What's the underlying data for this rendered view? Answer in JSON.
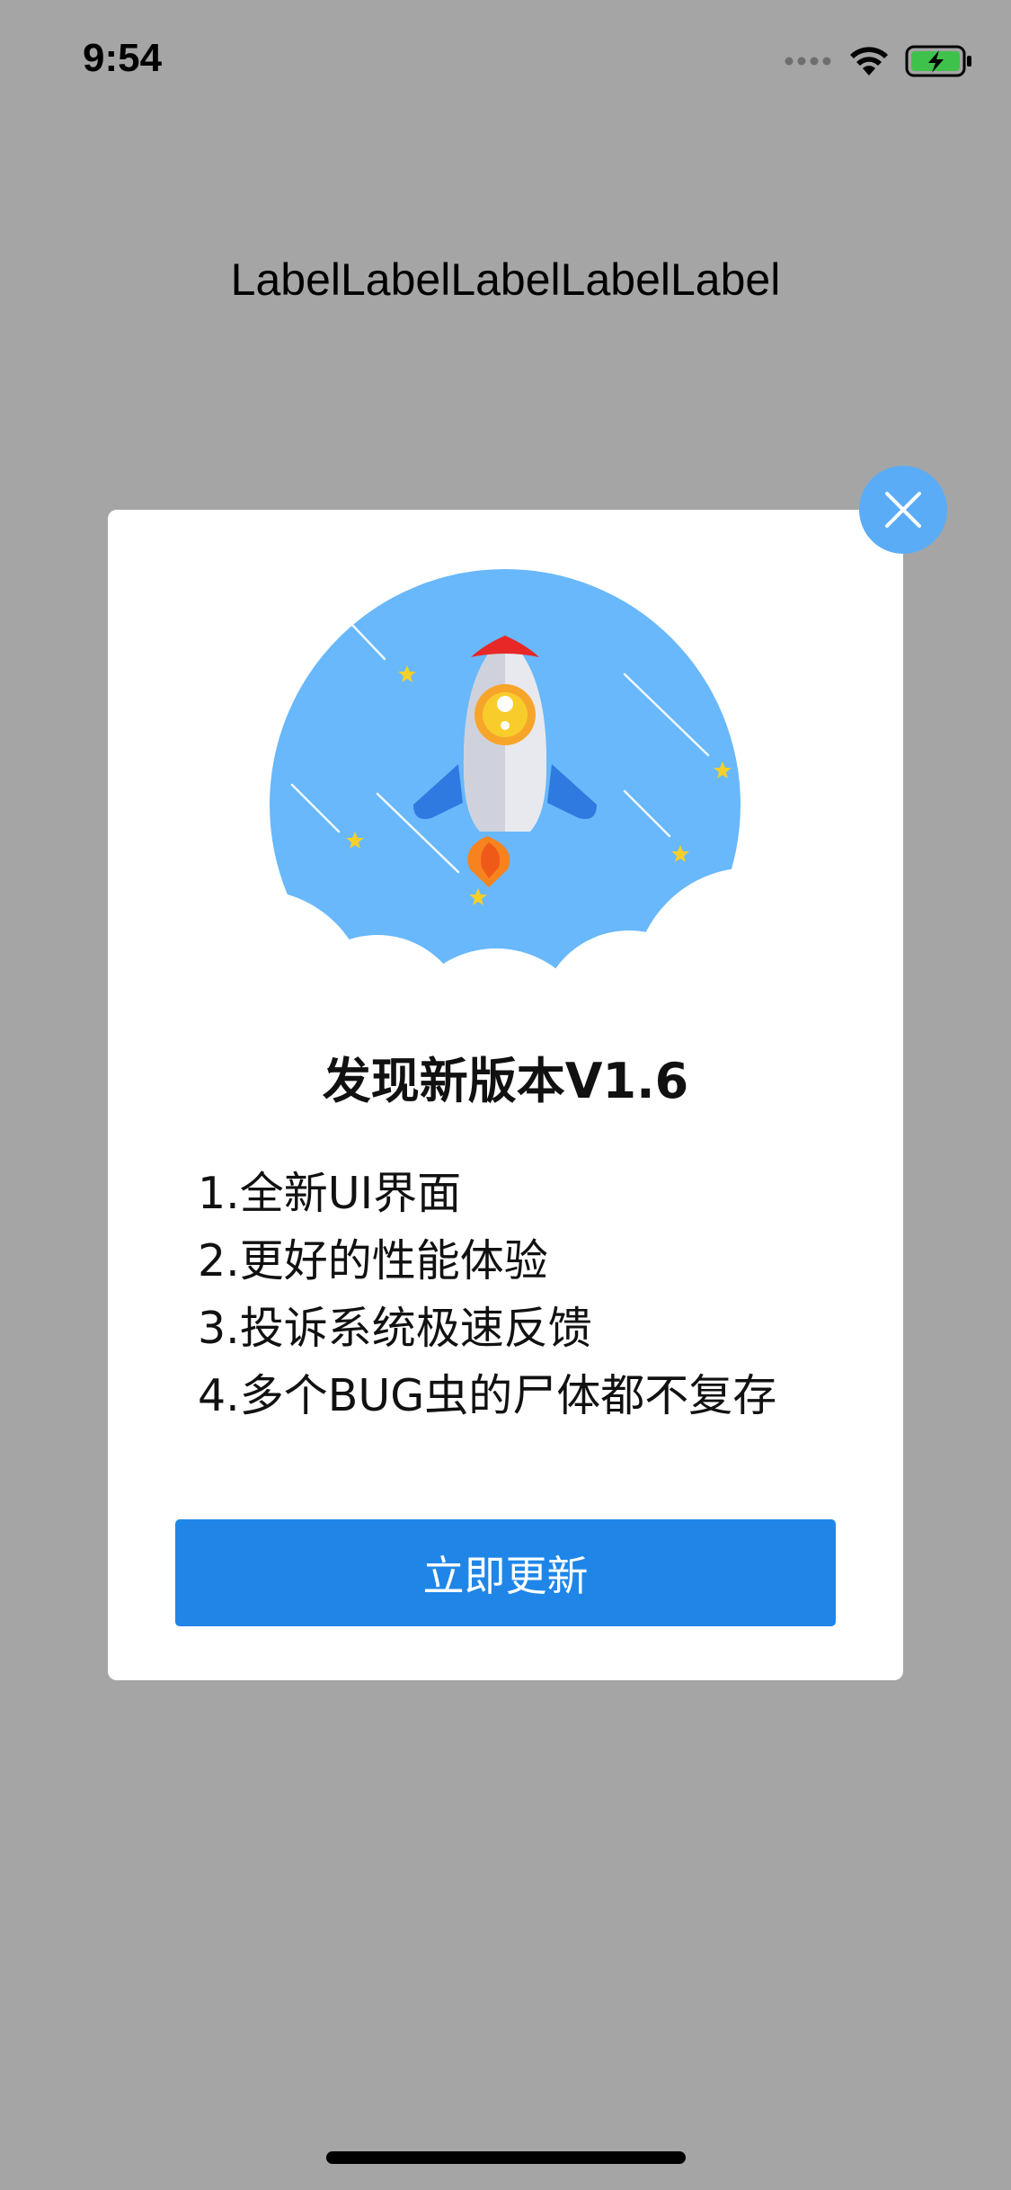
{
  "status_bar": {
    "time": "9:54",
    "icons": [
      "signal-dots-icon",
      "wifi-icon",
      "battery-charging-icon"
    ]
  },
  "header": {
    "label_text": "LabelLabelLabelLabelLabel"
  },
  "update_dialog": {
    "title": "发现新版本V1.6",
    "notes": [
      "1.全新UI界面",
      "2.更好的性能体验",
      "3.投诉系统极速反馈",
      "4.多个BUG虫的尸体都不复存"
    ],
    "update_button_label": "立即更新",
    "close_icon": "close-icon",
    "illustration": "rocket-illustration"
  },
  "colors": {
    "background": "#a5a5a5",
    "accent": "#1f86e8",
    "close_button": "#5aacf7",
    "illustration_sky": "#68b8fb"
  }
}
